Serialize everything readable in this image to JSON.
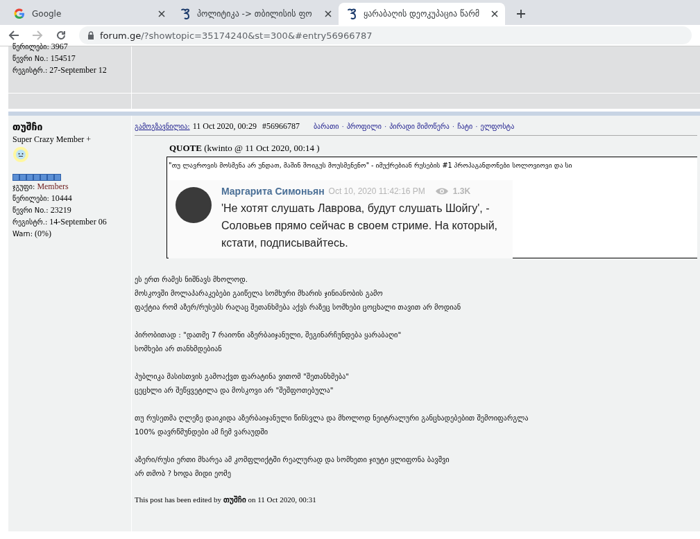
{
  "browser": {
    "tabs": [
      {
        "title": "Google",
        "kind": "google",
        "selected": false
      },
      {
        "title": "პოლიტიკა -> თბილისის ფო",
        "kind": "forum",
        "selected": false
      },
      {
        "title": "ყარაბაღის დეოკუპაცია წარმ",
        "kind": "forum",
        "selected": true
      }
    ],
    "address": {
      "domain": "forum.ge",
      "path": "/?showtopic=35174240&st=300&#entry56966787"
    }
  },
  "previous_post": {
    "profile": [
      {
        "label": "წერილები:",
        "value": "3967"
      },
      {
        "label": "წევრი No.:",
        "value": "154517"
      },
      {
        "label": "რეგისტრ.:",
        "value": "27-September 12"
      }
    ]
  },
  "post": {
    "author": {
      "name": "თუშჩი",
      "rank": "Super Crazy Member +"
    },
    "profile": [
      {
        "label": "ჯგუფი:",
        "value": "Members",
        "kind": "group"
      },
      {
        "label": "წერილები:",
        "value": "10444",
        "kind": "plain"
      },
      {
        "label": "წევრი No.:",
        "value": "23219",
        "kind": "plain"
      },
      {
        "label": "რეგისტრ.:",
        "value": "14-September 06",
        "kind": "plain"
      },
      {
        "label": "Warn:",
        "value": "(0%)",
        "kind": "plain"
      }
    ],
    "header": {
      "sent_label": "გამოგზავნილია:",
      "date": "11 Oct 2020, 00:29",
      "post_number": "#56966787",
      "links": [
        "ბარათი",
        "პროფილი",
        "პირადი მიმოწერა",
        "ჩატი",
        "ელფოსტა"
      ],
      "link_separator": "·"
    },
    "quote": {
      "title": "QUOTE",
      "meta": "(kwinto @ 11 Oct 2020, 00:14 )",
      "text": "\"თუ ლავროვის მოსმენა არ უნდათ, მაშინ შოიგუს მოუსმენენო\" - იმუქრებიან რუსების #1 პროპაგანდონები სოლოვიოვი და სი",
      "tweet": {
        "author": "Маргарита Симоньян",
        "time": "Oct 10, 2020 11:42:16 PM",
        "views": "1.3K",
        "text": "'Не хотят слушать Лаврова, будут слушать Шойгу', - Соловьев прямо сейчас в своем стриме. На который, кстати, подписывайтесь."
      }
    },
    "paragraphs": [
      [
        "ეს ერთ რამეს ნიშნავს მხოლოდ.",
        "მოსკოვში მოლაპარაკებები გაიწელა სომხური მხარის ჯინიანობის გამო",
        "ფაქტია რომ აზერ/რუსებს რაღაც შეთანხმება აქვს რაზეც სომხები ცოცხალი თავით არ მოდიან"
      ],
      [
        "პირობითად : \"დათმე 7 რაიონი აზერბაიჯანული, შეგინარჩუნდება ყარაბაღი\"",
        "სომხები არ თანხმდებიან"
      ],
      [
        "პუბლიკა მასისთვის გამოაქვთ ფარატინა ვითომ \"შეთანხმება\"",
        "ცეცხლი არ შეწყვეტილა და მოსკოვი არ \"შეშფოთებულა\""
      ],
      [
        "თუ რუსეთმა ღლეზე დაიკიდა აზერბაიჯანული წინსვლა და მხოლოდ ნეიტრალური განცხადებებით შემოიფარგლა",
        "100% დავრწმუნდები ამ ჩემ ვარაუდში"
      ],
      [
        "აზერი/რუსი ერთი მხარეა ამ კომფლიქტში რეალურად და სომხეთი ჯიუტი ყლიფონა ბავშვი",
        "არ თმობ ? ხოდა მიდი ეომე"
      ]
    ],
    "edited_note": "This post has been edited by **თუშჩი** on 11 Oct 2020, 00:31"
  }
}
